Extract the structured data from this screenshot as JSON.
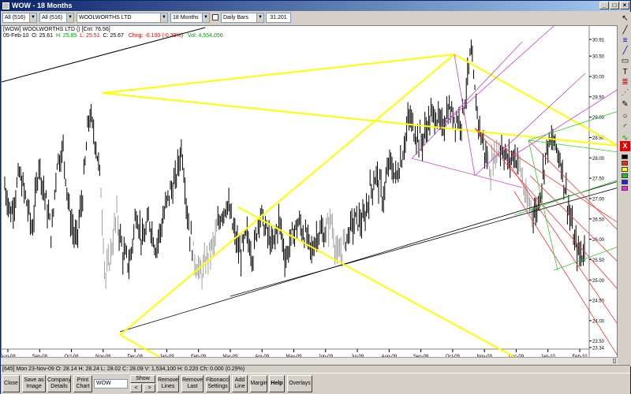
{
  "window": {
    "title": "WOW - 18 Months",
    "min": "_",
    "max": "□",
    "close": "×"
  },
  "toolbar": {
    "list1": "All (516)",
    "list2": "All (516)",
    "security": "WOOLWORTHS LTD",
    "period": "18 Months",
    "bars": "Daily Bars",
    "value": "31.201"
  },
  "header": {
    "line1": "[WOW] WOOLWORTHS LTD ()  [Cnt: 76.56]",
    "ohlc": {
      "date": "05-Feb-10",
      "open": "O: 25.61",
      "high": "H: 25.85",
      "low": "L: 25.51",
      "close": "C: 25.67",
      "chng": "Chng: -0.100 (-0.39%)",
      "vol": "Vol: 4,554,056"
    }
  },
  "chart_data": {
    "type": "line",
    "x_labels": [
      "Aug-08",
      "Sep-08",
      "Oct-08",
      "Nov-08",
      "Dec-08",
      "Jan-09",
      "Feb-09",
      "Mar-09",
      "Apr-09",
      "May-09",
      "Jun-09",
      "Jul-09",
      "Aug-09",
      "Sep-09",
      "Oct-09",
      "Nov-09",
      "Dec-09",
      "Jan-10",
      "Feb-10"
    ],
    "y_ticks": [
      "30.91",
      "30.50",
      "30.00",
      "29.50",
      "29.00",
      "28.50",
      "28.00",
      "27.50",
      "27.00",
      "26.50",
      "26.00",
      "25.50",
      "25.00",
      "24.50",
      "24.00",
      "23.50",
      "23.34"
    ],
    "ylim": [
      23.34,
      30.91
    ],
    "price_key_points": [
      [
        0,
        27.3
      ],
      [
        8,
        26.6
      ],
      [
        18,
        27.6
      ],
      [
        26,
        27.0
      ],
      [
        34,
        26.2
      ],
      [
        42,
        27.9
      ],
      [
        50,
        27.0
      ],
      [
        58,
        26.1
      ],
      [
        64,
        27.9
      ],
      [
        72,
        28.2
      ],
      [
        80,
        26.6
      ],
      [
        88,
        25.9
      ],
      [
        96,
        27.1
      ],
      [
        104,
        29.1
      ],
      [
        112,
        28.4
      ],
      [
        118,
        27.4
      ],
      [
        124,
        25.0
      ],
      [
        130,
        25.6
      ],
      [
        138,
        26.6
      ],
      [
        146,
        25.6
      ],
      [
        154,
        25.4
      ],
      [
        162,
        26.7
      ],
      [
        170,
        25.9
      ],
      [
        178,
        26.5
      ],
      [
        186,
        25.8
      ],
      [
        194,
        26.4
      ],
      [
        202,
        27.1
      ],
      [
        210,
        27.4
      ],
      [
        218,
        28.3
      ],
      [
        226,
        26.4
      ],
      [
        234,
        25.5
      ],
      [
        242,
        25.1
      ],
      [
        250,
        25.6
      ],
      [
        258,
        25.9
      ],
      [
        266,
        26.6
      ],
      [
        274,
        26.9
      ],
      [
        282,
        26.2
      ],
      [
        290,
        25.6
      ],
      [
        298,
        26.1
      ],
      [
        306,
        25.6
      ],
      [
        314,
        26.7
      ],
      [
        322,
        26.2
      ],
      [
        330,
        25.8
      ],
      [
        338,
        26.5
      ],
      [
        346,
        25.5
      ],
      [
        354,
        26.1
      ],
      [
        362,
        26.4
      ],
      [
        370,
        26.1
      ],
      [
        378,
        25.7
      ],
      [
        386,
        26.2
      ],
      [
        394,
        26.1
      ],
      [
        402,
        26.5
      ],
      [
        410,
        25.5
      ],
      [
        418,
        25.9
      ],
      [
        426,
        26.3
      ],
      [
        434,
        26.5
      ],
      [
        442,
        26.4
      ],
      [
        450,
        27.2
      ],
      [
        458,
        27.6
      ],
      [
        466,
        27.0
      ],
      [
        474,
        27.9
      ],
      [
        482,
        27.5
      ],
      [
        490,
        28.1
      ],
      [
        498,
        29.0
      ],
      [
        506,
        28.6
      ],
      [
        514,
        28.4
      ],
      [
        522,
        28.9
      ],
      [
        530,
        29.1
      ],
      [
        538,
        28.7
      ],
      [
        546,
        29.2
      ],
      [
        554,
        29.0
      ],
      [
        562,
        28.9
      ],
      [
        568,
        29.6
      ],
      [
        574,
        30.6
      ],
      [
        580,
        29.4
      ],
      [
        586,
        28.6
      ],
      [
        592,
        28.1
      ],
      [
        598,
        27.7
      ],
      [
        604,
        28.1
      ],
      [
        612,
        28.3
      ],
      [
        620,
        27.9
      ],
      [
        628,
        28.1
      ],
      [
        636,
        27.7
      ],
      [
        642,
        26.9
      ],
      [
        648,
        26.8
      ],
      [
        654,
        26.6
      ],
      [
        660,
        27.2
      ],
      [
        668,
        28.3
      ],
      [
        676,
        28.4
      ],
      [
        684,
        28.0
      ],
      [
        690,
        27.3
      ],
      [
        696,
        26.6
      ],
      [
        702,
        25.9
      ],
      [
        708,
        25.6
      ],
      [
        714,
        25.7
      ]
    ]
  },
  "palette": {
    "pointer": "↖",
    "line": "╱",
    "pen": "✎",
    "text": "T",
    "circle": "○"
  },
  "status_bar": "[645]  Mon 23-Nov-09  O: 28.14  H: 28.24  L: 28.02  C: 28.09  V: 1,534,100  H: 0.220  Ch: 0.000 (0.29%)",
  "bottom_bar": {
    "close": "Close",
    "save_image": "Save as Image",
    "company_details": "Company Details",
    "print_chart": "Print Chart",
    "symbol": "WOW",
    "show": "Show",
    "prev": "<",
    "next": ">",
    "remove_lines": "Remove Lines",
    "remove_last": "Remove Last",
    "fib_settings": "Fibonacci Settings",
    "add_line": "Add Line",
    "margin": "Margin",
    "help": "Help",
    "overlays": "Overlays"
  },
  "colors": {
    "yellow": "#ffff00",
    "magenta": "#cc44cc",
    "red": "#ff3333",
    "green": "#33cc33",
    "black": "#000000"
  }
}
